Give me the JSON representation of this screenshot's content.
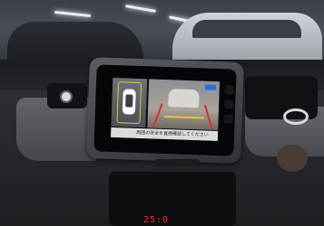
{
  "scene": {
    "description_hidden": "",
    "camera_view": {
      "status_text": "周囲の安全を直接確認してください",
      "accent_guide_color": "#e8c23a",
      "warning_line_color": "#e02b2b"
    },
    "clock_readout": "25:0"
  }
}
